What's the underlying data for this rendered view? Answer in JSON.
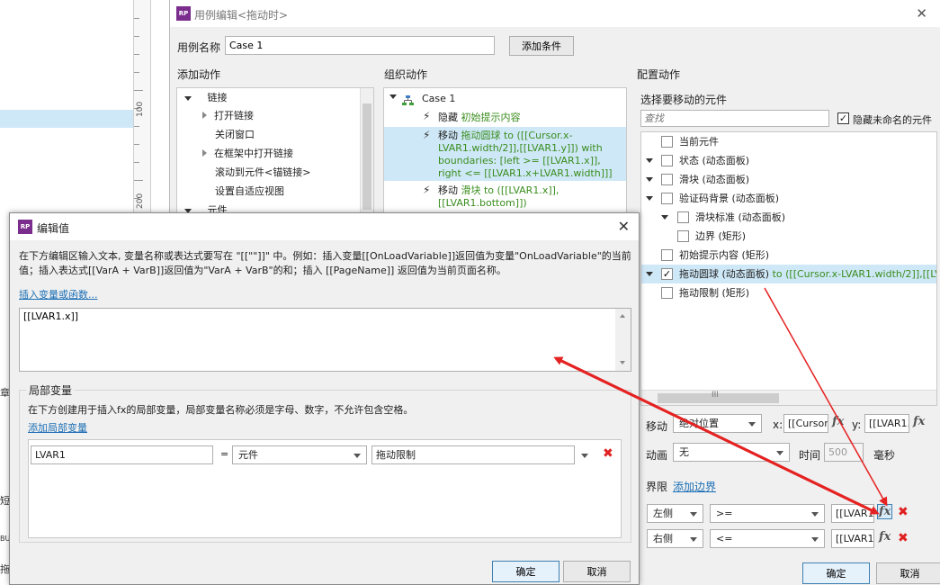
{
  "background": {
    "ruler_labels": [
      "100",
      "200"
    ],
    "fragments": [
      "章",
      "短",
      "BU",
      "拖"
    ]
  },
  "main_dialog": {
    "title": "用例编辑<拖动时>",
    "case_name_label": "用例名称",
    "case_name_value": "Case 1",
    "add_condition_label": "添加条件",
    "add_action_title": "添加动作",
    "organize_action_title": "组织动作",
    "configure_action_title": "配置动作"
  },
  "add_actions": {
    "group_links": "链接",
    "items": [
      "打开链接",
      "关闭窗口",
      "在框架中打开链接",
      "滚动到元件<锚链接>",
      "设置自适应视图"
    ],
    "group_widgets": "元件"
  },
  "organize": {
    "case_label": "Case 1",
    "actions": [
      {
        "verb": "隐藏",
        "detail": "初始提示内容",
        "tail": ""
      },
      {
        "verb": "移动",
        "detail": "拖动圆球 to ([[Cursor.x-LVAR1.width/2]],[[LVAR1.y]]) with",
        "tail": "boundaries: [left >= [[LVAR1.x]], right <= [[LVAR1.x+LVAR1.width]]]"
      },
      {
        "verb": "移动",
        "detail": "滑块 to ([[LVAR1.x]], [[LVAR1.bottom]])",
        "tail": ""
      }
    ]
  },
  "configure": {
    "select_widget_title": "选择要移动的元件",
    "search_placeholder": "查找",
    "hide_unnamed_label": "隐藏未命名的元件",
    "tree": [
      {
        "label": "当前元件",
        "checked": false
      },
      {
        "label": "状态 (动态面板)",
        "checked": false
      },
      {
        "label": "滑块 (动态面板)",
        "checked": false
      },
      {
        "label": "验证码背景 (动态面板)",
        "checked": false
      },
      {
        "label": "滑块标准 (动态面板)",
        "checked": false
      },
      {
        "label": "边界 (矩形)",
        "checked": false
      },
      {
        "label": "初始提示内容 (矩形)",
        "checked": false
      },
      {
        "label": "拖动圆球 (动态面板)",
        "suffix": " to ([[Cursor.x-LVAR1.width/2]],[[LVAR1",
        "checked": true
      },
      {
        "label": "拖动限制 (矩形)",
        "checked": false
      }
    ],
    "hscroll_text": "III",
    "move_label": "移动",
    "move_mode": "绝对位置",
    "x_label": "x:",
    "x_value": "[[Cursor",
    "y_label": "y:",
    "y_value": "[[LVAR1.",
    "fx_label": "fx",
    "animate_label": "动画",
    "animate_value": "无",
    "time_label": "时间",
    "time_value": "500",
    "ms_label": "毫秒",
    "bounds_label": "界限",
    "add_bound_link": "添加边界",
    "bounds": [
      {
        "side": "左侧",
        "op": ">=",
        "value": "[[LVAR1."
      },
      {
        "side": "右侧",
        "op": "<=",
        "value": "[[LVAR1."
      }
    ],
    "ok_label": "确定",
    "cancel_label": "取消"
  },
  "edit_value": {
    "title": "编辑值",
    "instructions": "在下方编辑区输入文本, 变量名称或表达式要写在 \"[[\"\"]]\" 中。例如：插入变量[[OnLoadVariable]]返回值为变量\"OnLoadVariable\"的当前值；插入表达式[[VarA + VarB]]返回值为\"VarA + VarB\"的和；插入 [[PageName]] 返回值为当前页面名称。",
    "insert_link": "插入变量或函数...",
    "expression": "[[LVAR1.x]]",
    "local_vars_title": "局部变量",
    "local_vars_desc": "在下方创建用于插入fx的局部变量，局部变量名称必须是字母、数字，不允许包含空格。",
    "add_local_link": "添加局部变量",
    "var": {
      "name": "LVAR1",
      "equals": "=",
      "type": "元件",
      "target": "拖动限制"
    },
    "ok_label": "确定",
    "cancel_label": "取消"
  },
  "colors": {
    "logo": "#7b2d8e",
    "selection": "#cfe8f7",
    "link": "#1c6fb5",
    "green_text": "#3a8d1e",
    "delete_red": "#e02020",
    "arrow_red": "#e52222"
  },
  "icons": [
    "rp-logo-icon",
    "close-icon",
    "lightning-icon",
    "network-icon",
    "delete-icon",
    "chevron-down-icon",
    "checkbox-icon"
  ]
}
